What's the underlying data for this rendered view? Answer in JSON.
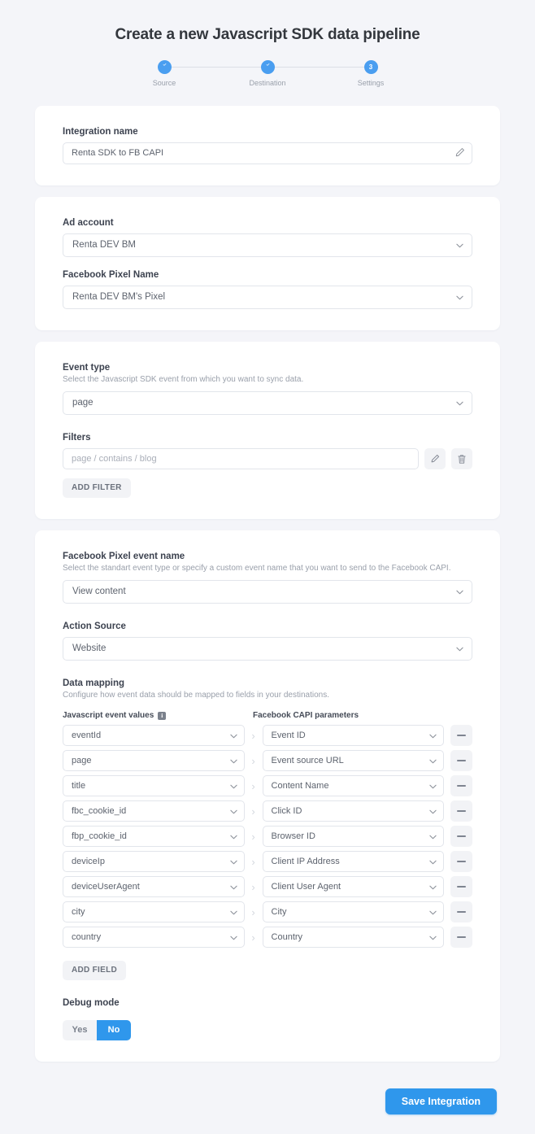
{
  "header": {
    "title": "Create a new Javascript SDK data pipeline",
    "steps": [
      {
        "label": "Source",
        "state": "done",
        "marker": "check"
      },
      {
        "label": "Destination",
        "state": "done",
        "marker": "check"
      },
      {
        "label": "Settings",
        "state": "current",
        "marker": "3"
      }
    ]
  },
  "integration": {
    "label": "Integration name",
    "value": "Renta SDK to FB CAPI",
    "placeholder": "Integration name",
    "edit_icon": "pencil-icon"
  },
  "account": {
    "ad_account_label": "Ad account",
    "ad_account_value": "Renta DEV BM",
    "pixel_label": "Facebook Pixel Name",
    "pixel_value": "Renta DEV BM's Pixel"
  },
  "event": {
    "type_label": "Event type",
    "type_hint": "Select the Javascript SDK event from which you want to sync data.",
    "type_value": "page",
    "filters_label": "Filters",
    "filter_placeholder": "page / contains / blog",
    "filter_edit_icon": "pencil-icon",
    "filter_delete_icon": "trash-icon",
    "add_filter_label": "ADD FILTER"
  },
  "pixel_event": {
    "name_label": "Facebook Pixel event name",
    "name_hint": "Select the standart event type or specify a custom event name that you want to send to the Facebook CAPI.",
    "name_value": "View content",
    "action_source_label": "Action Source",
    "action_source_value": "Website"
  },
  "mapping": {
    "title": "Data mapping",
    "hint": "Configure how event data should be mapped to fields in your destinations.",
    "left_header": "Javascript event values",
    "left_header_icon": "info-icon",
    "right_header": "Facebook CAPI parameters",
    "arrow": "›",
    "rows": [
      {
        "source": "eventId",
        "target": "Event ID"
      },
      {
        "source": "page",
        "target": "Event source URL"
      },
      {
        "source": "title",
        "target": "Content Name"
      },
      {
        "source": "fbc_cookie_id",
        "target": "Click ID"
      },
      {
        "source": "fbp_cookie_id",
        "target": "Browser ID"
      },
      {
        "source": "deviceIp",
        "target": "Client IP Address"
      },
      {
        "source": "deviceUserAgent",
        "target": "Client User Agent"
      },
      {
        "source": "city",
        "target": "City"
      },
      {
        "source": "country",
        "target": "Country"
      }
    ],
    "add_field_label": "ADD FIELD"
  },
  "debug": {
    "label": "Debug mode",
    "options": [
      "Yes",
      "No"
    ],
    "selected": "No"
  },
  "footer": {
    "save_label": "Save Integration"
  },
  "colors": {
    "accent": "#2f97ec",
    "step_blue": "#4a9ef0",
    "page_bg": "#f4f5f9",
    "card_bg": "#ffffff",
    "border": "#e2e5eb",
    "muted_text": "#9aa0ab"
  }
}
